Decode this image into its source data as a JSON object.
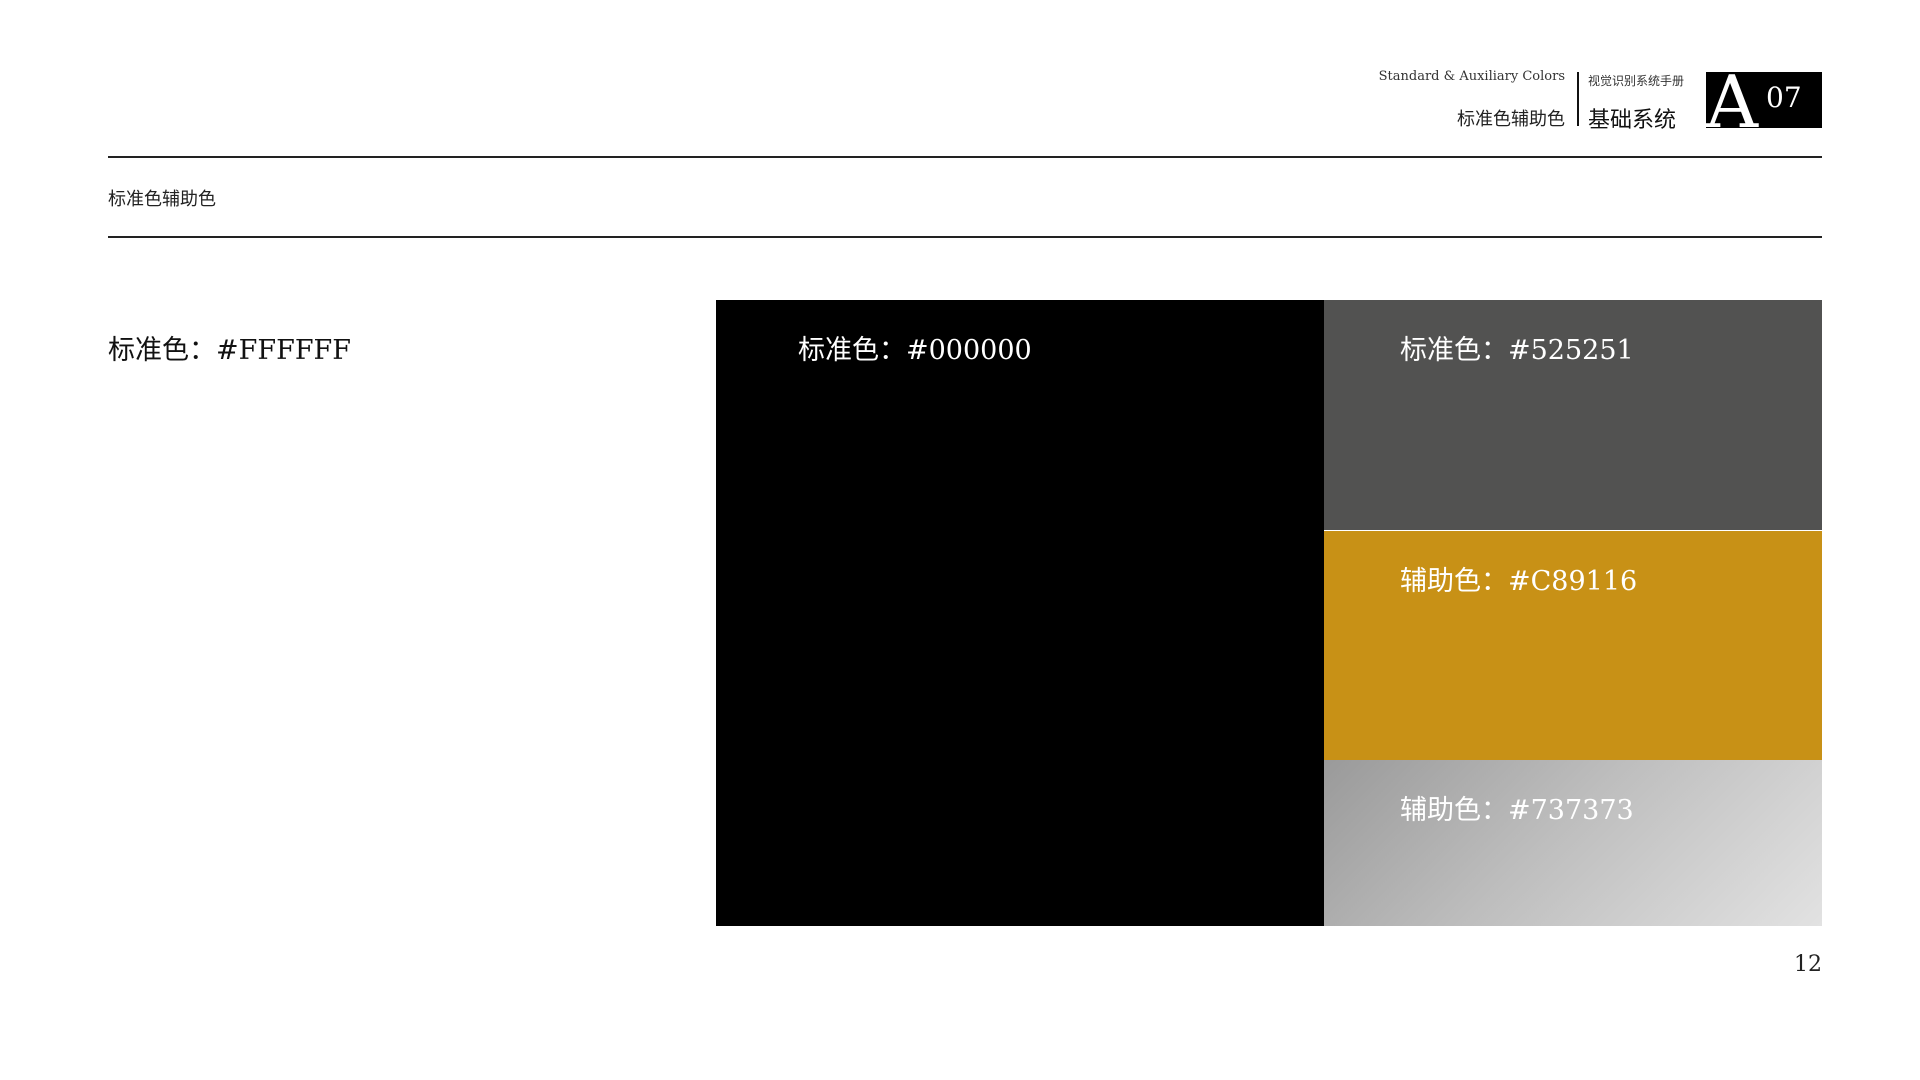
{
  "header": {
    "en_title": "Standard & Auxiliary Colors",
    "cn_title_left": "标准色辅助色",
    "manual_title": "视觉识别系统手册",
    "section_name": "基础系统",
    "badge_letter": "A",
    "badge_number": "07"
  },
  "section": {
    "title": "标准色辅助色"
  },
  "swatches": {
    "white": {
      "label": "标准色：#FFFFFF",
      "color": "#FFFFFF"
    },
    "black": {
      "label": "标准色：#000000",
      "color": "#000000"
    },
    "gray": {
      "label": "标准色：#525251",
      "color": "#525251"
    },
    "gold": {
      "label": "辅助色：#C89116",
      "color": "#C89116"
    },
    "silver": {
      "label": "辅助色：#737373",
      "color": "#737373"
    }
  },
  "page": {
    "number": "12"
  }
}
